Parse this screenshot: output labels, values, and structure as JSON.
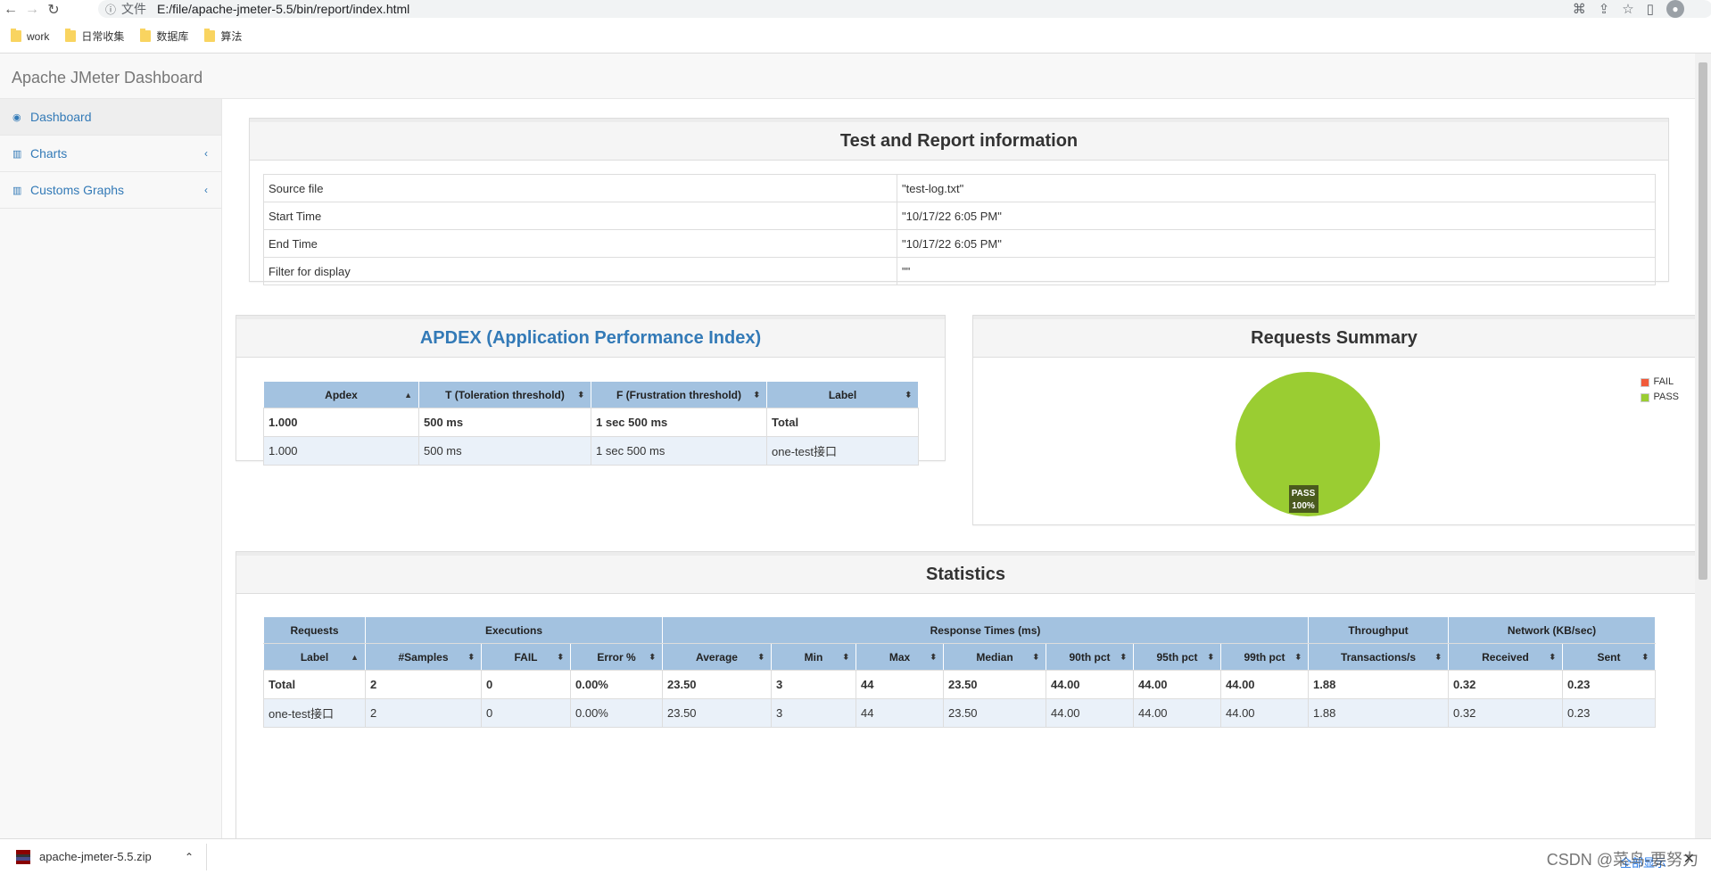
{
  "browser": {
    "url_prefix": "文件",
    "url": "E:/file/apache-jmeter-5.5/bin/report/index.html",
    "bookmarks": [
      "work",
      "日常收集",
      "数据库",
      "算法"
    ]
  },
  "app": {
    "title": "Apache JMeter Dashboard"
  },
  "sidebar": {
    "items": [
      {
        "label": "Dashboard",
        "icon": "dashboard-icon"
      },
      {
        "label": "Charts",
        "icon": "bar-chart-icon"
      },
      {
        "label": "Customs Graphs",
        "icon": "bar-chart-icon"
      }
    ]
  },
  "report_info": {
    "title": "Test and Report information",
    "rows": [
      {
        "key": "Source file",
        "value": "\"test-log.txt\""
      },
      {
        "key": "Start Time",
        "value": "\"10/17/22 6:05 PM\""
      },
      {
        "key": "End Time",
        "value": "\"10/17/22 6:05 PM\""
      },
      {
        "key": "Filter for display",
        "value": "\"\""
      }
    ]
  },
  "apdex": {
    "title": "APDEX (Application Performance Index)",
    "headers": [
      "Apdex",
      "T (Toleration threshold)",
      "F (Frustration threshold)",
      "Label"
    ],
    "rows": [
      [
        "1.000",
        "500 ms",
        "1 sec 500 ms",
        "Total"
      ],
      [
        "1.000",
        "500 ms",
        "1 sec 500 ms",
        "one-test接口"
      ]
    ]
  },
  "requests_summary": {
    "title": "Requests Summary",
    "legend": [
      {
        "label": "FAIL",
        "color": "#f15a3a"
      },
      {
        "label": "PASS",
        "color": "#9acd32"
      }
    ],
    "pie_label": "PASS",
    "pie_pct": "100%"
  },
  "statistics": {
    "title": "Statistics",
    "groups": [
      "Requests",
      "Executions",
      "Response Times (ms)",
      "Throughput",
      "Network (KB/sec)"
    ],
    "headers": [
      "Label",
      "#Samples",
      "FAIL",
      "Error %",
      "Average",
      "Min",
      "Max",
      "Median",
      "90th pct",
      "95th pct",
      "99th pct",
      "Transactions/s",
      "Received",
      "Sent"
    ],
    "rows": [
      [
        "Total",
        "2",
        "0",
        "0.00%",
        "23.50",
        "3",
        "44",
        "23.50",
        "44.00",
        "44.00",
        "44.00",
        "1.88",
        "0.32",
        "0.23"
      ],
      [
        "one-test接口",
        "2",
        "0",
        "0.00%",
        "23.50",
        "3",
        "44",
        "23.50",
        "44.00",
        "44.00",
        "44.00",
        "1.88",
        "0.32",
        "0.23"
      ]
    ]
  },
  "downloads": {
    "file": "apache-jmeter-5.5.zip",
    "show_all": "全部显示"
  },
  "watermark": "CSDN @菜鸟-要努力",
  "chart_data": {
    "type": "pie",
    "title": "Requests Summary",
    "categories": [
      "FAIL",
      "PASS"
    ],
    "values": [
      0,
      100
    ]
  }
}
